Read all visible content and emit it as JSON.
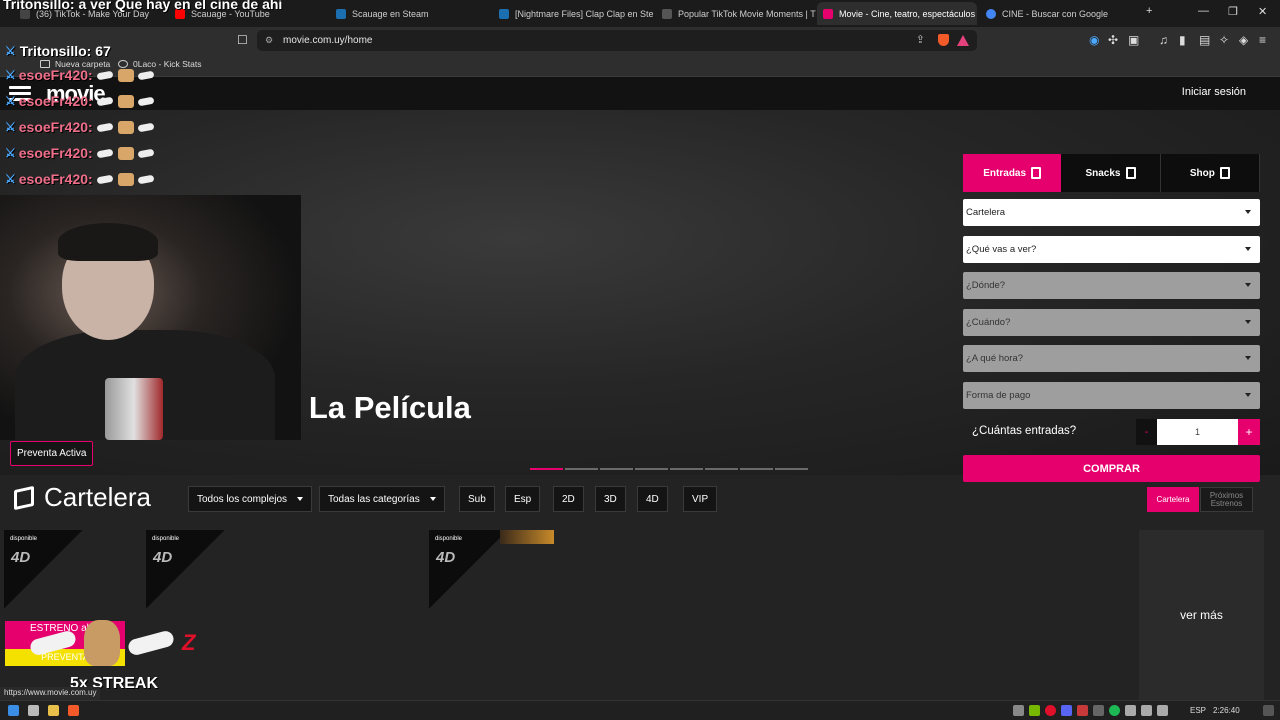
{
  "browser": {
    "tabs": [
      {
        "label": "(36) TikTok - Make Your Day",
        "color": "#444444"
      },
      {
        "label": "Scauage - YouTube",
        "color": "#ff0000"
      },
      {
        "label": "Scauage en Steam",
        "color": "#1b6fb0"
      },
      {
        "label": "[Nightmare Files] Clap Clap en Steam",
        "color": "#1b6fb0"
      },
      {
        "label": "Popular TikTok Movie Moments | TikTok",
        "color": "#555555"
      },
      {
        "label": "Movie - Cine, teatro, espectáculos",
        "color": "#e5006d"
      },
      {
        "label": "CINE - Buscar con Google",
        "color": "#4285f4"
      }
    ],
    "active_tab_index": 5,
    "url": "movie.com.uy/home",
    "bookmarks": [
      "Nueva carpeta",
      "0Laco - Kick Stats"
    ]
  },
  "site": {
    "logo": "movie",
    "login": "Iniciar sesión",
    "hero_title": ": La Película",
    "preventa": "Preventa Activa",
    "purchase": {
      "tabs": [
        "Entradas",
        "Snacks",
        "Shop"
      ],
      "selects": [
        {
          "label": "Cartelera",
          "enabled": true
        },
        {
          "label": "¿Qué vas a ver?",
          "enabled": true
        },
        {
          "label": "¿Dónde?",
          "enabled": false
        },
        {
          "label": "¿Cuándo?",
          "enabled": false
        },
        {
          "label": "¿A qué hora?",
          "enabled": false
        },
        {
          "label": "Forma de pago",
          "enabled": false
        }
      ],
      "qty_label": "¿Cuántas entradas?",
      "minus": "-",
      "qty": "1",
      "plus": "+",
      "buy": "COMPRAR"
    },
    "cartelera": {
      "title": "Cartelera",
      "filters": [
        "Todos los complejos",
        "Todas las categorías"
      ],
      "formats": [
        "Sub",
        "Esp",
        "2D",
        "3D",
        "4D",
        "VIP"
      ],
      "view_tabs": [
        "Cartelera",
        "Próximos Estrenos"
      ],
      "card_badge": "disponible",
      "card_format": "4D",
      "ver_mas": "ver más",
      "banner_top": "ESTRENO abril",
      "banner_bottom": "PREVENTA"
    }
  },
  "stream": {
    "chat": [
      {
        "user": "Tritonsillo",
        "text": "a ver Que hay en el cine de ahi"
      },
      {
        "user": "Tritonsillo",
        "text": "67"
      },
      {
        "user": "esoeFr420",
        "text": ""
      },
      {
        "user": "esoeFr420",
        "text": ""
      },
      {
        "user": "esoeFr420",
        "text": ""
      },
      {
        "user": "esoeFr420",
        "text": ""
      },
      {
        "user": "esoeFr420",
        "text": ""
      }
    ],
    "streak": "5x STREAK"
  },
  "status_url": "https://www.movie.com.uy",
  "taskbar": {
    "lang": "ESP",
    "time": "2:26:40"
  }
}
